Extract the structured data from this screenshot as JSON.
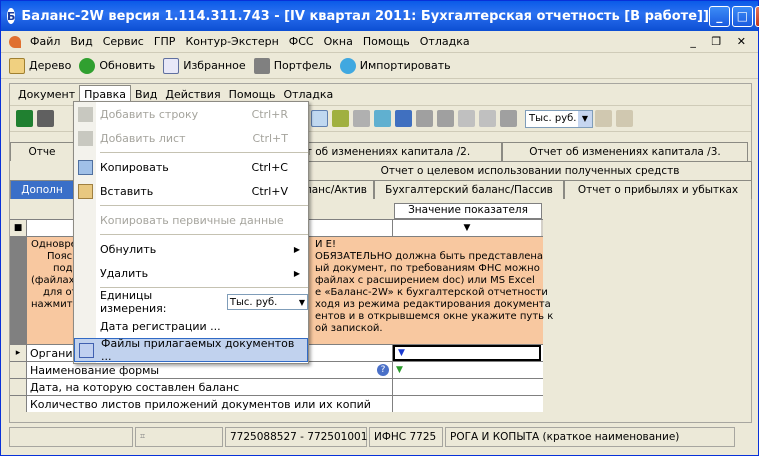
{
  "window": {
    "title": "Баланс-2W  версия 1.114.311.743 - [IV квартал 2011: Бухгалтерская отчетность [В работе]]",
    "icon": "app-logo-icon"
  },
  "menubar": {
    "items": [
      "Файл",
      "Вид",
      "Сервис",
      "ГПР",
      "Контур-Экстерн",
      "ФСС",
      "Окна",
      "Помощь",
      "Отладка"
    ],
    "mdi_controls": "_ ❐ ✕"
  },
  "toolbar1": {
    "items": [
      {
        "label": "Дерево",
        "icon": "tree-icon"
      },
      {
        "label": "Обновить",
        "icon": "refresh-icon"
      },
      {
        "label": "Избранное",
        "icon": "favorites-icon"
      },
      {
        "label": "Портфель",
        "icon": "portfolio-icon"
      },
      {
        "label": "Импортировать",
        "icon": "import-icon"
      }
    ]
  },
  "inner_menu": {
    "items": [
      "Документ",
      "Правка",
      "Вид",
      "Действия",
      "Помощь",
      "Отладка"
    ]
  },
  "toolbar2": {
    "unit_value": "Тыс. руб."
  },
  "tabs": {
    "row1": [
      "Отче",
      "т об изменениях капитала /2.",
      "Отчет об изменениях капитала /3."
    ],
    "row2": [
      "Отчет о целевом использовании полученных средств"
    ],
    "row3": [
      "Дополн",
      "ланс/Актив",
      "Бухгалтерский баланс/Пассив",
      "Отчет о прибылях и убытках"
    ]
  },
  "grid": {
    "value_header": "Значение показателя",
    "note_lines": [
      "Одновре",
      "Поясн",
      "подг",
      "(файлах",
      "для от",
      "нажмит"
    ],
    "note_right": [
      "И Е!",
      "ОБЯЗАТЕЛЬНО должна быть  представлена",
      "ый документ, по требованиям ФНС можно",
      "файлах с расширением doc) или MS Excel",
      "е «Баланс-2W» к бухгалтерской отчетности",
      "ходя из режима редактирования документа",
      "ентов и в открывшемся окне укажите путь к",
      "ой запиской."
    ],
    "rows": [
      {
        "name": "Организ",
        "value": ""
      },
      {
        "name": "Наименование формы",
        "value": ""
      },
      {
        "name": "Дата, на которую составлен баланс",
        "value": ""
      },
      {
        "name": "Количество листов приложений документов или их копий",
        "value": ""
      }
    ]
  },
  "dropdown": {
    "items": [
      {
        "label": "Добавить строку",
        "shortcut": "Ctrl+R",
        "disabled": true,
        "icon": "add-row-icon"
      },
      {
        "label": "Добавить лист",
        "shortcut": "Ctrl+T",
        "disabled": true,
        "icon": "add-sheet-icon"
      },
      {
        "label": "Копировать",
        "shortcut": "Ctrl+C",
        "disabled": false,
        "icon": "copy-icon"
      },
      {
        "label": "Вставить",
        "shortcut": "Ctrl+V",
        "disabled": false,
        "icon": "paste-icon"
      },
      {
        "label": "Копировать первичные данные",
        "shortcut": "",
        "disabled": true
      },
      {
        "label": "Обнулить",
        "shortcut": "",
        "disabled": false
      },
      {
        "label": "Удалить",
        "shortcut": "",
        "disabled": false
      },
      {
        "label": "Единицы измерения:",
        "unit": "Тыс. руб.",
        "disabled": false
      },
      {
        "label": "Дата регистрации ...",
        "shortcut": "",
        "disabled": false
      },
      {
        "label": "Файлы прилагаемых документов ...",
        "shortcut": "",
        "disabled": false,
        "icon": "attach-files-icon"
      }
    ]
  },
  "statusbar": {
    "inn_kpp": "7725088527 - 772501001",
    "ifns": "ИФНС 7725",
    "org": "РОГА И КОПЫТА (краткое наименование)"
  }
}
